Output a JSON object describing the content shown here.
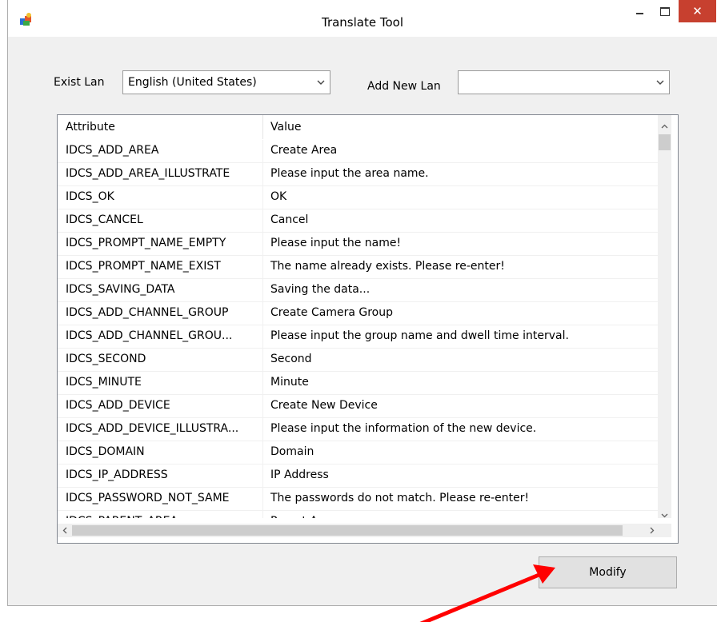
{
  "window": {
    "title": "Translate Tool",
    "close_glyph": "✕",
    "accent": "#c7402f"
  },
  "form": {
    "exist_lan_label": "Exist Lan",
    "exist_lan_value": "English (United States)",
    "add_new_lan_label": "Add New Lan",
    "add_new_lan_value": ""
  },
  "table": {
    "headers": {
      "attribute": "Attribute",
      "value": "Value"
    },
    "rows": [
      {
        "attribute": "IDCS_ADD_AREA",
        "value": "Create Area"
      },
      {
        "attribute": "IDCS_ADD_AREA_ILLUSTRATE",
        "value": "Please input the area name."
      },
      {
        "attribute": "IDCS_OK",
        "value": "OK"
      },
      {
        "attribute": "IDCS_CANCEL",
        "value": "Cancel"
      },
      {
        "attribute": "IDCS_PROMPT_NAME_EMPTY",
        "value": "Please input the name!"
      },
      {
        "attribute": "IDCS_PROMPT_NAME_EXIST",
        "value": "The name already exists. Please re-enter!"
      },
      {
        "attribute": "IDCS_SAVING_DATA",
        "value": "Saving the data..."
      },
      {
        "attribute": "IDCS_ADD_CHANNEL_GROUP",
        "value": "Create Camera Group"
      },
      {
        "attribute": "IDCS_ADD_CHANNEL_GROU...",
        "value": "Please input the group name and dwell time interval."
      },
      {
        "attribute": "IDCS_SECOND",
        "value": "Second"
      },
      {
        "attribute": "IDCS_MINUTE",
        "value": "Minute"
      },
      {
        "attribute": "IDCS_ADD_DEVICE",
        "value": "Create New Device"
      },
      {
        "attribute": "IDCS_ADD_DEVICE_ILLUSTRA...",
        "value": "Please input the information of the new device."
      },
      {
        "attribute": "IDCS_DOMAIN",
        "value": "Domain"
      },
      {
        "attribute": "IDCS_IP_ADDRESS",
        "value": "IP Address"
      },
      {
        "attribute": "IDCS_PASSWORD_NOT_SAME",
        "value": "The passwords do not match. Please re-enter!"
      },
      {
        "attribute": "IDCS_PARENT_AREA",
        "value": "Parent Area"
      }
    ]
  },
  "buttons": {
    "modify": "Modify"
  },
  "annotation": {
    "arrow_color": "#ff0000"
  }
}
